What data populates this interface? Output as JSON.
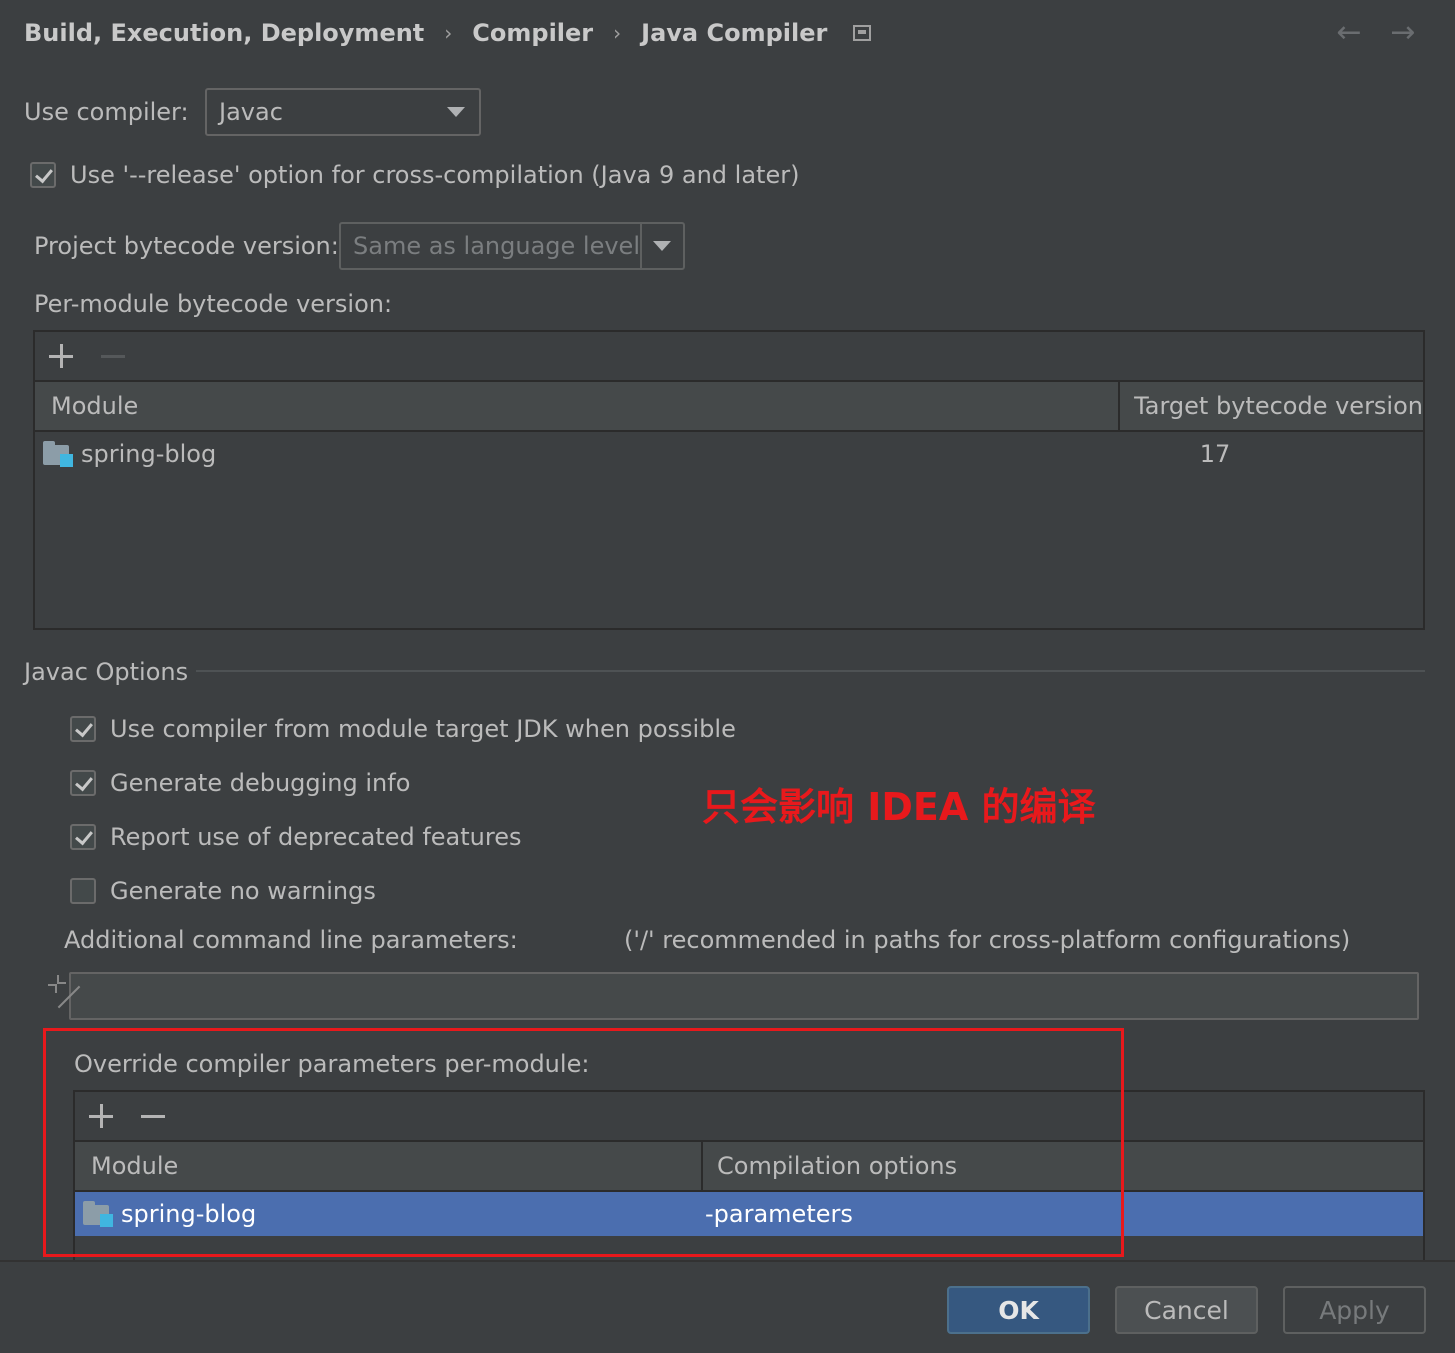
{
  "breadcrumb": {
    "items": [
      "Build, Execution, Deployment",
      "Compiler",
      "Java Compiler"
    ],
    "separator": "›"
  },
  "nav": {
    "back_glyph": "←",
    "forward_glyph": "→"
  },
  "use_compiler": {
    "label": "Use compiler:",
    "value": "Javac"
  },
  "release_option": {
    "label": "Use '--release' option for cross-compilation (Java 9 and later)",
    "checked": true
  },
  "project_bytecode": {
    "label": "Project bytecode version:",
    "value": "Same as language level"
  },
  "per_module": {
    "label": "Per-module bytecode version:",
    "columns": [
      "Module",
      "Target bytecode version"
    ],
    "rows": [
      {
        "module": "spring-blog",
        "version": "17"
      }
    ]
  },
  "javac_options": {
    "title": "Javac Options",
    "checkboxes": [
      {
        "label": "Use compiler from module target JDK when possible",
        "checked": true
      },
      {
        "label": "Generate debugging info",
        "checked": true
      },
      {
        "label": "Report use of deprecated features",
        "checked": true
      },
      {
        "label": "Generate no warnings",
        "checked": false
      }
    ],
    "additional_params_label": "Additional command line parameters:",
    "additional_params_hint": "('/' recommended in paths for cross-platform configurations)",
    "additional_params_value": ""
  },
  "annotation": {
    "text": "只会影响 IDEA 的编译",
    "color": "#e8191c"
  },
  "override": {
    "label": "Override compiler parameters per-module:",
    "columns": [
      "Module",
      "Compilation options"
    ],
    "rows": [
      {
        "module": "spring-blog",
        "options": "-parameters",
        "selected": true
      }
    ]
  },
  "buttons": {
    "ok": "OK",
    "cancel": "Cancel",
    "apply": "Apply"
  },
  "colors": {
    "background": "#3c3f41",
    "selection": "#4b6eaf",
    "default_button": "#365880"
  }
}
